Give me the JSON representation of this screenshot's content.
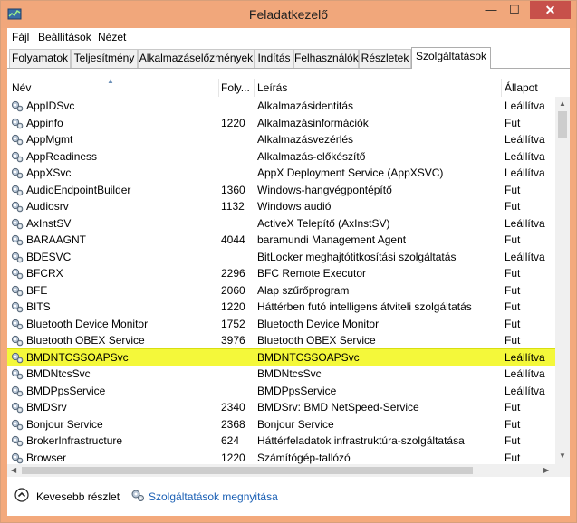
{
  "window": {
    "title": "Feladatkezelő",
    "controls": {
      "minimize": "—",
      "maximize": "☐",
      "close": "✕"
    }
  },
  "menu": [
    "Fájl",
    "Beállítások",
    "Nézet"
  ],
  "tabs": [
    "Folyamatok",
    "Teljesítmény",
    "Alkalmazáselőzmények",
    "Indítás",
    "Felhasználók",
    "Részletek",
    "Szolgáltatások"
  ],
  "active_tab": "Szolgáltatások",
  "columns": {
    "name": "Név",
    "pid": "Foly...",
    "desc": "Leírás",
    "status": "Állapot"
  },
  "services": [
    {
      "name": "AppIDSvc",
      "pid": "",
      "desc": "Alkalmazásidentitás",
      "status": "Leállítva"
    },
    {
      "name": "Appinfo",
      "pid": "1220",
      "desc": "Alkalmazásinformációk",
      "status": "Fut"
    },
    {
      "name": "AppMgmt",
      "pid": "",
      "desc": "Alkalmazásvezérlés",
      "status": "Leállítva"
    },
    {
      "name": "AppReadiness",
      "pid": "",
      "desc": "Alkalmazás-előkészítő",
      "status": "Leállítva"
    },
    {
      "name": "AppXSvc",
      "pid": "",
      "desc": "AppX Deployment Service (AppXSVC)",
      "status": "Leállítva"
    },
    {
      "name": "AudioEndpointBuilder",
      "pid": "1360",
      "desc": "Windows-hangvégpontépítő",
      "status": "Fut"
    },
    {
      "name": "Audiosrv",
      "pid": "1132",
      "desc": "Windows audió",
      "status": "Fut"
    },
    {
      "name": "AxInstSV",
      "pid": "",
      "desc": "ActiveX Telepítő (AxInstSV)",
      "status": "Leállítva"
    },
    {
      "name": "BARAAGNT",
      "pid": "4044",
      "desc": "baramundi Management Agent",
      "status": "Fut"
    },
    {
      "name": "BDESVC",
      "pid": "",
      "desc": "BitLocker meghajtótitkosítási szolgáltatás",
      "status": "Leállítva"
    },
    {
      "name": "BFCRX",
      "pid": "2296",
      "desc": "BFC Remote Executor",
      "status": "Fut"
    },
    {
      "name": "BFE",
      "pid": "2060",
      "desc": "Alap szűrőprogram",
      "status": "Fut"
    },
    {
      "name": "BITS",
      "pid": "1220",
      "desc": "Háttérben futó intelligens átviteli szolgáltatás",
      "status": "Fut"
    },
    {
      "name": "Bluetooth Device Monitor",
      "pid": "1752",
      "desc": "Bluetooth Device Monitor",
      "status": "Fut"
    },
    {
      "name": "Bluetooth OBEX Service",
      "pid": "3976",
      "desc": "Bluetooth OBEX Service",
      "status": "Fut"
    },
    {
      "name": "BMDNTCSSOAPSvc",
      "pid": "",
      "desc": "BMDNTCSSOAPSvc",
      "status": "Leállítva",
      "highlighted": true
    },
    {
      "name": "BMDNtcsSvc",
      "pid": "",
      "desc": "BMDNtcsSvc",
      "status": "Leállítva"
    },
    {
      "name": "BMDPpsService",
      "pid": "",
      "desc": "BMDPpsService",
      "status": "Leállítva"
    },
    {
      "name": "BMDSrv",
      "pid": "2340",
      "desc": "BMDSrv: BMD NetSpeed-Service",
      "status": "Fut"
    },
    {
      "name": "Bonjour Service",
      "pid": "2368",
      "desc": "Bonjour Service",
      "status": "Fut"
    },
    {
      "name": "BrokerInfrastructure",
      "pid": "624",
      "desc": "Háttérfeladatok infrastruktúra-szolgáltatása",
      "status": "Fut"
    },
    {
      "name": "Browser",
      "pid": "1220",
      "desc": "Számítógép-tallózó",
      "status": "Fut"
    }
  ],
  "footer": {
    "fewer_details": "Kevesebb részlet",
    "open_services": "Szolgáltatások megnyitása"
  },
  "colors": {
    "titlebar": "#f1a77b",
    "close": "#c7504a",
    "highlight": "#f4f83a",
    "link": "#1a5fb4"
  }
}
